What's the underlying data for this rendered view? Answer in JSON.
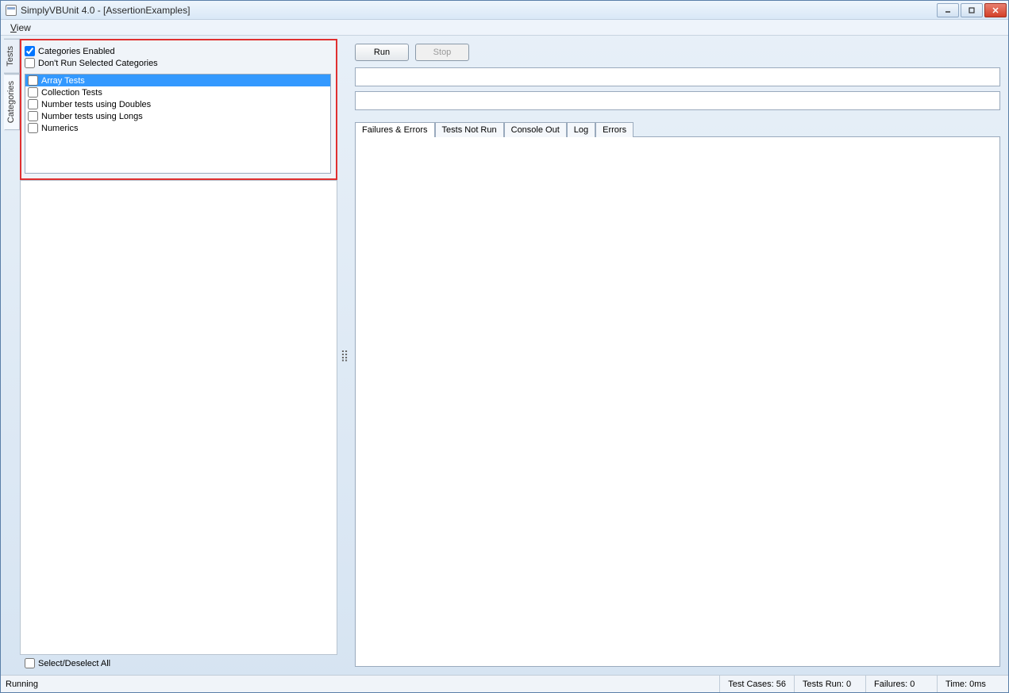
{
  "window": {
    "title": "SimplyVBUnit 4.0 - [AssertionExamples]"
  },
  "menubar": {
    "view": "View"
  },
  "sidebar_tabs": {
    "tests": "Tests",
    "categories": "Categories"
  },
  "options": {
    "categories_enabled": "Categories Enabled",
    "dont_run_selected": "Don't Run Selected Categories"
  },
  "categories": [
    {
      "label": "Array Tests",
      "selected": true,
      "checked": false
    },
    {
      "label": "Collection Tests",
      "selected": false,
      "checked": false
    },
    {
      "label": "Number tests using Doubles",
      "selected": false,
      "checked": false
    },
    {
      "label": "Number tests using Longs",
      "selected": false,
      "checked": false
    },
    {
      "label": "Numerics",
      "selected": false,
      "checked": false
    }
  ],
  "select_all": "Select/Deselect All",
  "buttons": {
    "run": "Run",
    "stop": "Stop"
  },
  "result_tabs": {
    "failures": "Failures & Errors",
    "not_run": "Tests Not Run",
    "console": "Console Out",
    "log": "Log",
    "errors": "Errors"
  },
  "status": {
    "running": "Running",
    "test_cases": "Test Cases: 56",
    "tests_run": "Tests Run: 0",
    "failures": "Failures: 0",
    "time": "Time: 0ms"
  }
}
